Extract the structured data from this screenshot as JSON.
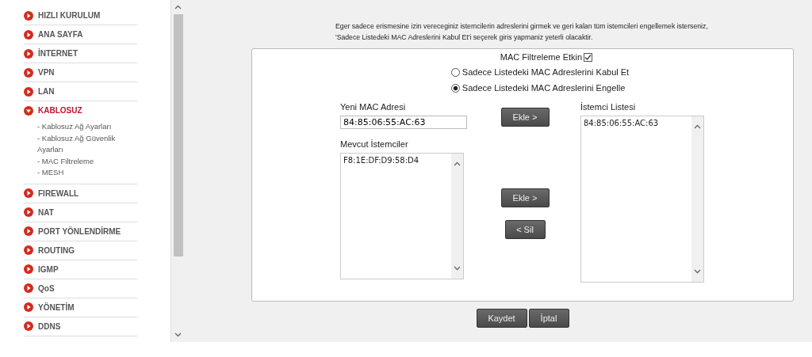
{
  "sidebar": {
    "items": [
      {
        "label": "HIZLI KURULUM",
        "expanded": false
      },
      {
        "label": "ANA SAYFA",
        "expanded": false
      },
      {
        "label": "İNTERNET",
        "expanded": false
      },
      {
        "label": "VPN",
        "expanded": false
      },
      {
        "label": "LAN",
        "expanded": false
      },
      {
        "label": "KABLOSUZ",
        "expanded": true,
        "children": [
          {
            "label": "- Kablosuz Ağ Ayarları"
          },
          {
            "label": "- Kablosuz Ağ Güvenlik Ayarları"
          },
          {
            "label": "- MAC Filtreleme"
          },
          {
            "label": "- MESH"
          }
        ]
      },
      {
        "label": "FIREWALL",
        "expanded": false
      },
      {
        "label": "NAT",
        "expanded": false
      },
      {
        "label": "PORT YÖNLENDİRME",
        "expanded": false
      },
      {
        "label": "ROUTING",
        "expanded": false
      },
      {
        "label": "IGMP",
        "expanded": false
      },
      {
        "label": "QoS",
        "expanded": false
      },
      {
        "label": "YÖNETİM",
        "expanded": false
      },
      {
        "label": "DDNS",
        "expanded": false
      }
    ]
  },
  "intro": "Eger sadece erismesine izin vereceginiz istemcilerin adreslerini girmek ve geri kalan tüm istemcileri engellemek isterseniz, 'Sadece Listedeki MAC Adreslerini Kabul Et'i seçerek giris yapmaniz yeterli olacaktir.",
  "filter": {
    "label": "MAC Filtreleme Etkin",
    "checked": true
  },
  "modes": [
    {
      "label": "Sadece Listedeki MAC Adreslerini Kabul Et",
      "selected": false
    },
    {
      "label": "Sadece Listedeki MAC Adreslerini Engelle",
      "selected": true
    }
  ],
  "new_mac": {
    "label": "Yeni MAC Adresi",
    "value": "84:85:06:55:AC:63"
  },
  "current_clients": {
    "label": "Mevcut İstemciler",
    "items": [
      "F8:1E:DF:D9:58:D4"
    ]
  },
  "client_list": {
    "label": "İstemci Listesi",
    "items": [
      "84:85:06:55:AC:63"
    ]
  },
  "add_mac_button": "Ekle >",
  "add_client_button": "Ekle >",
  "remove_button": "< Sil",
  "footer_buttons": [
    "Kaydet",
    "İptal"
  ]
}
